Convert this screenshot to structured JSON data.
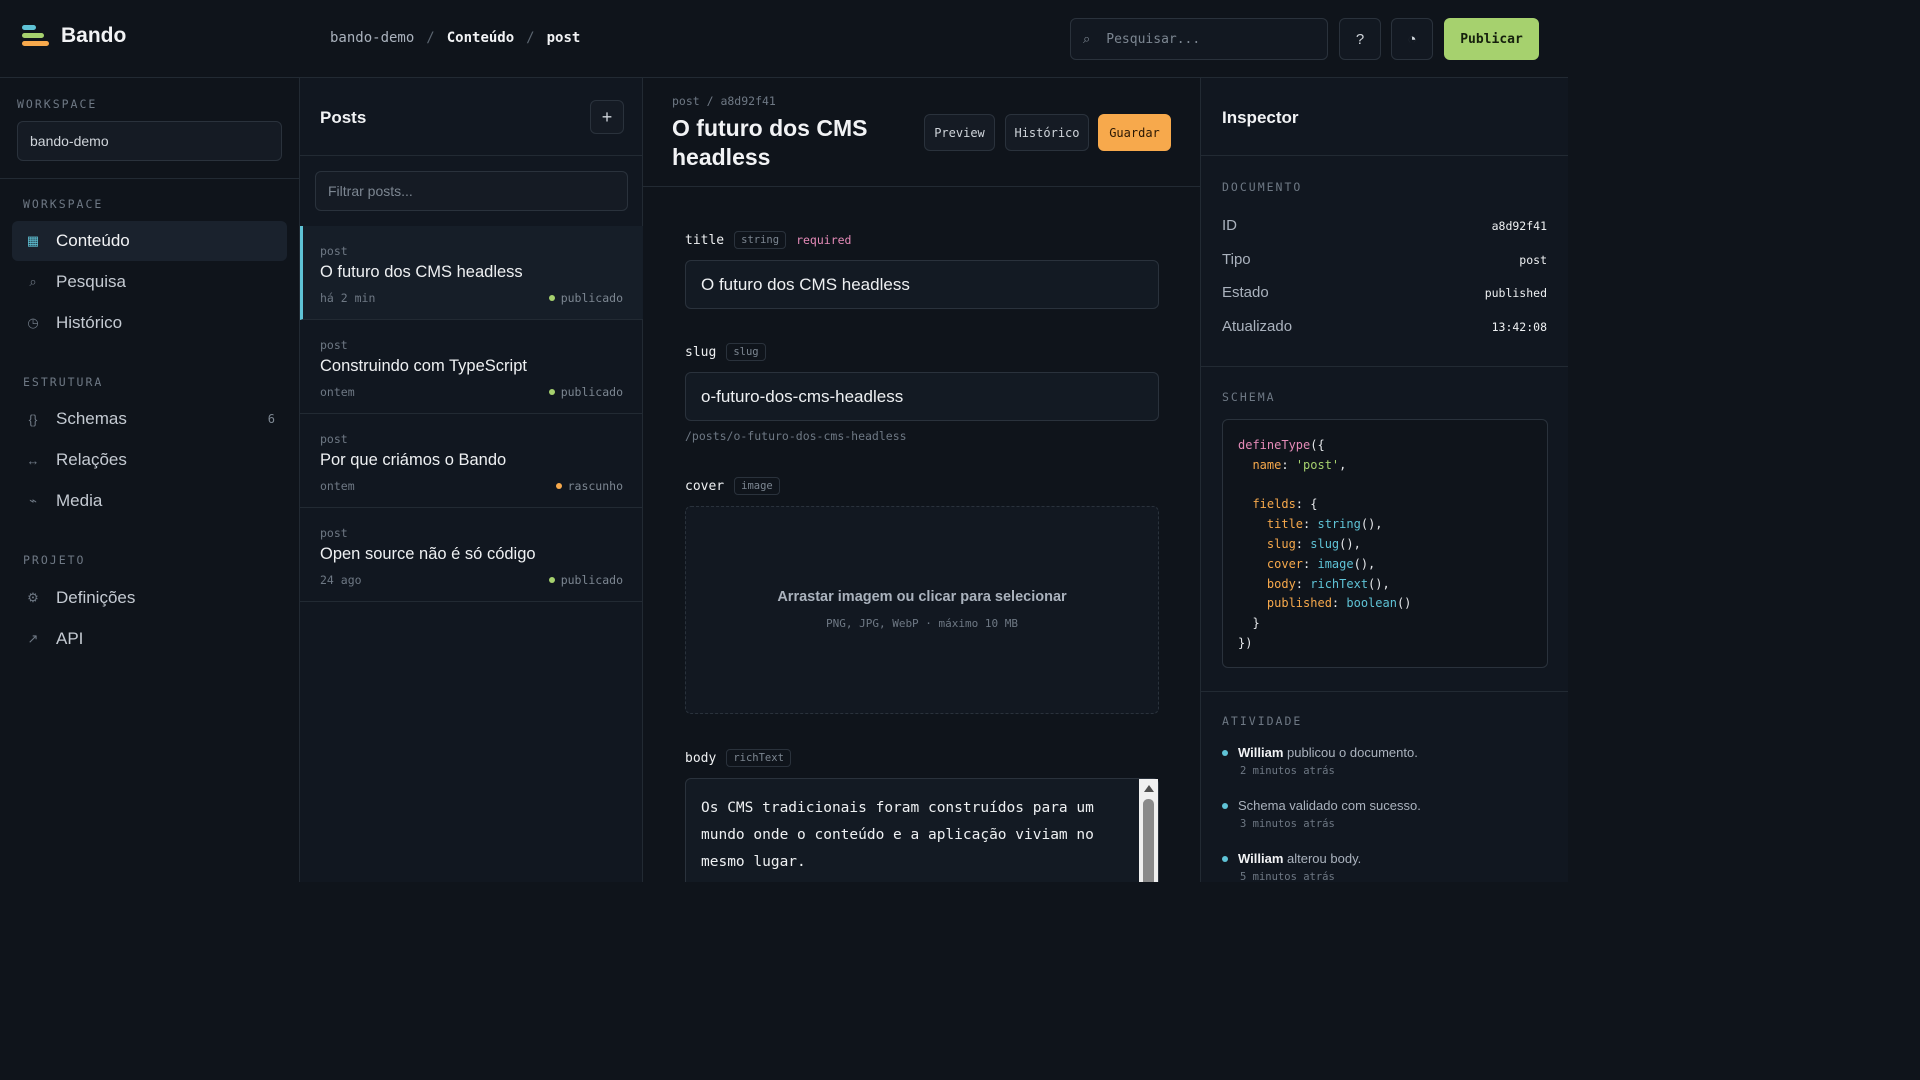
{
  "brand": {
    "name": "Bando",
    "colors": [
      "#5fc3d6",
      "#a6d16e",
      "#f7a94c"
    ]
  },
  "breadcrumb": {
    "workspace": "bando-demo",
    "section": "Conteúdo",
    "type": "post"
  },
  "topbar": {
    "search_placeholder": "Pesquisar...",
    "help_icon": "?",
    "theme_icon": "◔",
    "publish_label": "Publicar"
  },
  "sidebar": {
    "workspace_label": "WORKSPACE",
    "workspace_value": "bando-demo",
    "sections": [
      {
        "label": "WORKSPACE",
        "items": [
          {
            "label": "Conteúdo",
            "icon": "▦",
            "active": true
          },
          {
            "label": "Pesquisa",
            "icon": "⌕"
          },
          {
            "label": "Histórico",
            "icon": "◷"
          }
        ]
      },
      {
        "label": "ESTRUTURA",
        "items": [
          {
            "label": "Schemas",
            "icon": "{}",
            "count": "6"
          },
          {
            "label": "Relações",
            "icon": "↔"
          },
          {
            "label": "Media",
            "icon": "⌁"
          }
        ]
      },
      {
        "label": "PROJETO",
        "items": [
          {
            "label": "Definições",
            "icon": "⚙"
          },
          {
            "label": "API",
            "icon": "↗"
          }
        ]
      }
    ]
  },
  "posts": {
    "title": "Posts",
    "add_label": "+",
    "filter_placeholder": "Filtrar posts...",
    "items": [
      {
        "type": "post",
        "title": "O futuro dos CMS headless",
        "time": "há 2 min",
        "status": "publicado",
        "status_color": "#a6d16e",
        "active": true
      },
      {
        "type": "post",
        "title": "Construindo com TypeScript",
        "time": "ontem",
        "status": "publicado",
        "status_color": "#a6d16e"
      },
      {
        "type": "post",
        "title": "Por que criámos o Bando",
        "time": "ontem",
        "status": "rascunho",
        "status_color": "#f7a94c"
      },
      {
        "type": "post",
        "title": "Open source não é só código",
        "time": "24 ago",
        "status": "publicado",
        "status_color": "#a6d16e"
      }
    ]
  },
  "editor": {
    "path": "post / a8d92f41",
    "title": "O futuro dos CMS headless",
    "buttons": {
      "preview": "Preview",
      "history": "Histórico",
      "save": "Guardar"
    },
    "fields": {
      "title": {
        "name": "title",
        "type": "string",
        "required": "required",
        "value": "O futuro dos CMS headless"
      },
      "slug": {
        "name": "slug",
        "type": "slug",
        "value": "o-futuro-dos-cms-headless",
        "hint": "/posts/o-futuro-dos-cms-headless"
      },
      "cover": {
        "name": "cover",
        "type": "image",
        "drop_text": "Arrastar imagem ou clicar para selecionar",
        "drop_hint": "PNG, JPG, WebP · máximo 10 MB"
      },
      "body": {
        "name": "body",
        "type": "richText",
        "value": "Os CMS tradicionais foram construídos para um mundo onde o conteúdo e a aplicação viviam no mesmo lugar."
      }
    }
  },
  "inspector": {
    "title": "Inspector",
    "document_label": "DOCUMENTO",
    "document": [
      {
        "key": "ID",
        "value": "a8d92f41"
      },
      {
        "key": "Tipo",
        "value": "post"
      },
      {
        "key": "Estado",
        "value": "published"
      },
      {
        "key": "Atualizado",
        "value": "13:42:08"
      }
    ],
    "schema_label": "SCHEMA",
    "schema_lines": [
      [
        [
          "defineType",
          "fn"
        ],
        [
          "({",
          ""
        ]
      ],
      [
        [
          "  name",
          "key"
        ],
        [
          ": ",
          ""
        ],
        [
          "'post'",
          "str"
        ],
        [
          ",",
          ""
        ]
      ],
      [
        [
          "",
          ""
        ]
      ],
      [
        [
          "  fields",
          "key"
        ],
        [
          ": {",
          ""
        ]
      ],
      [
        [
          "    title",
          "key"
        ],
        [
          ": ",
          ""
        ],
        [
          "string",
          "type"
        ],
        [
          "(),",
          ""
        ]
      ],
      [
        [
          "    slug",
          "key"
        ],
        [
          ": ",
          ""
        ],
        [
          "slug",
          "type"
        ],
        [
          "(),",
          ""
        ]
      ],
      [
        [
          "    cover",
          "key"
        ],
        [
          ": ",
          ""
        ],
        [
          "image",
          "type"
        ],
        [
          "(),",
          ""
        ]
      ],
      [
        [
          "    body",
          "key"
        ],
        [
          ": ",
          ""
        ],
        [
          "richText",
          "type"
        ],
        [
          "(),",
          ""
        ]
      ],
      [
        [
          "    published",
          "key"
        ],
        [
          ": ",
          ""
        ],
        [
          "boolean",
          "type"
        ],
        [
          "()",
          ""
        ]
      ],
      [
        [
          "  }",
          ""
        ]
      ],
      [
        [
          "})",
          ""
        ]
      ]
    ],
    "activity_label": "ATIVIDADE",
    "activity": [
      {
        "user": "William",
        "text": " publicou o documento.",
        "when": "2 minutos atrás"
      },
      {
        "user": "",
        "text": "Schema validado com sucesso.",
        "when": "3 minutos atrás"
      },
      {
        "user": "William",
        "text": " alterou body.",
        "when": "5 minutos atrás"
      }
    ],
    "activity_dot_color": "#5fc3d6"
  }
}
